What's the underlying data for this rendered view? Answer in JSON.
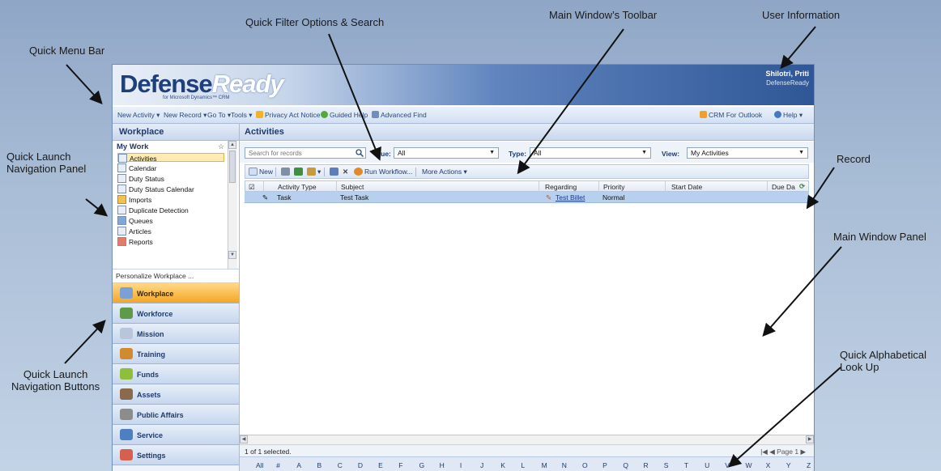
{
  "callouts": {
    "quick_menu_bar": "Quick Menu Bar",
    "quick_filter": "Quick Filter Options & Search",
    "main_toolbar": "Main Window’s Toolbar",
    "user_info": "User Information",
    "quick_launch_panel_1": "Quick Launch",
    "quick_launch_panel_2": "Navigation Panel",
    "record": "Record",
    "main_window_panel": "Main Window Panel",
    "quick_launch_buttons_1": "Quick Launch",
    "quick_launch_buttons_2": "Navigation Buttons",
    "alpha_lookup_1": "Quick Alphabetical",
    "alpha_lookup_2": "Look Up"
  },
  "banner": {
    "logo_primary": "Defense",
    "logo_secondary": "Ready",
    "logo_sub": "for Microsoft Dynamics™ CRM",
    "user_name": "Shilotri, Priti",
    "user_org": "DefenseReady"
  },
  "menubar": {
    "new_activity": "New Activity ▾",
    "new_record": "New Record ▾",
    "go_to": "Go To ▾",
    "tools": "Tools ▾",
    "privacy": "Privacy Act Notice",
    "guided_help": "Guided Help",
    "advanced_find": "Advanced Find",
    "crm_outlook": "CRM For Outlook",
    "help": "Help ▾"
  },
  "nav": {
    "header": "Workplace",
    "my_work": "My Work",
    "items": [
      "Activities",
      "Calendar",
      "Duty Status",
      "Duty Status Calendar",
      "Imports",
      "Duplicate Detection",
      "Queues",
      "Articles",
      "Reports"
    ],
    "personalize": "Personalize Workplace ...",
    "panes": [
      "Workplace",
      "Workforce",
      "Mission",
      "Training",
      "Funds",
      "Assets",
      "Public Affairs",
      "Service",
      "Settings"
    ]
  },
  "main": {
    "title": "Activities",
    "search_placeholder": "Search for records",
    "due_label": "Due:",
    "due_value": "All",
    "type_label": "Type:",
    "type_value": "All",
    "view_label": "View:",
    "view_value": "My Activities"
  },
  "toolbar": {
    "new": "New",
    "run_workflow": "Run Workflow...",
    "more_actions": "More Actions ▾"
  },
  "grid": {
    "columns": [
      "Activity Type",
      "Subject",
      "Regarding",
      "Priority",
      "Start Date",
      "Due Da"
    ],
    "row": {
      "activity_type": "Task",
      "subject": "Test Task",
      "regarding": "Test Billet",
      "priority": "Normal"
    }
  },
  "status": {
    "selection": "1 of 1 selected.",
    "pager": "Page 1"
  },
  "alphabet": [
    "All",
    "#",
    "A",
    "B",
    "C",
    "D",
    "E",
    "F",
    "G",
    "H",
    "I",
    "J",
    "K",
    "L",
    "M",
    "N",
    "O",
    "P",
    "Q",
    "R",
    "S",
    "T",
    "U",
    "V",
    "W",
    "X",
    "Y",
    "Z"
  ]
}
